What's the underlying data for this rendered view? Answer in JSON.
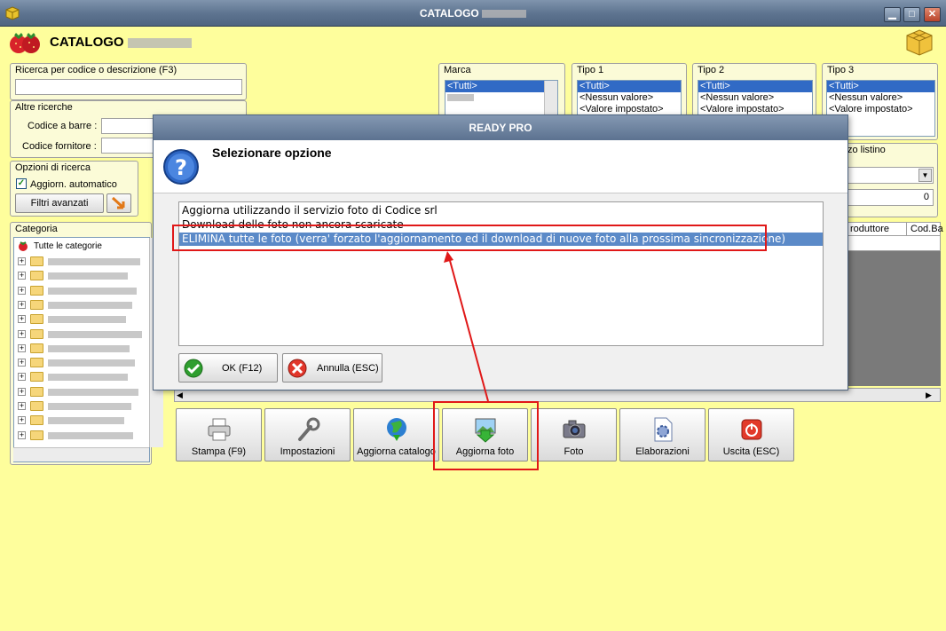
{
  "window": {
    "title": "CATALOGO",
    "header_title": "CATALOGO"
  },
  "search": {
    "code_desc_label": "Ricerca per codice o descrizione (F3)",
    "other_label": "Altre ricerche",
    "barcode_label": "Codice a barre :",
    "supplier_code_label": "Codice fornitore :",
    "options_label": "Opzioni di ricerca",
    "auto_update_label": "Aggiorn. automatico",
    "advanced_filters_label": "Filtri avanzati"
  },
  "filters": {
    "marca": {
      "label": "Marca",
      "items": [
        "<Tutti>"
      ]
    },
    "tipo1": {
      "label": "Tipo 1",
      "items": [
        "<Tutti>",
        "<Nessun valore>",
        "<Valore impostato>"
      ]
    },
    "tipo2": {
      "label": "Tipo 2",
      "items": [
        "<Tutti>",
        "<Nessun valore>",
        "<Valore impostato>"
      ]
    },
    "tipo3": {
      "label": "Tipo 3",
      "items": [
        "<Tutti>",
        "<Nessun valore>",
        "<Valore impostato>"
      ]
    },
    "listino_label": "zo listino",
    "listino_value": "0"
  },
  "category": {
    "label": "Categoria",
    "root": "Tutte le categorie"
  },
  "grid": {
    "columns": [
      "roduttore",
      "Cod.Ba"
    ]
  },
  "toolbar": {
    "buttons": [
      "Stampa (F9)",
      "Impostazioni",
      "Aggiorna catalogo",
      "Aggiorna foto",
      "Foto",
      "Elaborazioni",
      "Uscita (ESC)"
    ]
  },
  "dialog": {
    "title": "READY PRO",
    "heading": "Selezionare opzione",
    "options": [
      "Aggiorna utilizzando il servizio foto di Codice srl",
      "Download delle foto non ancora scaricate",
      "ELIMINA tutte le foto (verra' forzato l'aggiornamento ed il download di nuove foto alla prossima sincronizzazione)"
    ],
    "ok_label": "OK (F12)",
    "cancel_label": "Annulla (ESC)"
  },
  "colors": {
    "background": "#fefe9c",
    "titlebar": "#5f7591",
    "selection": "#316ac5",
    "highlight_red": "#e01818"
  }
}
